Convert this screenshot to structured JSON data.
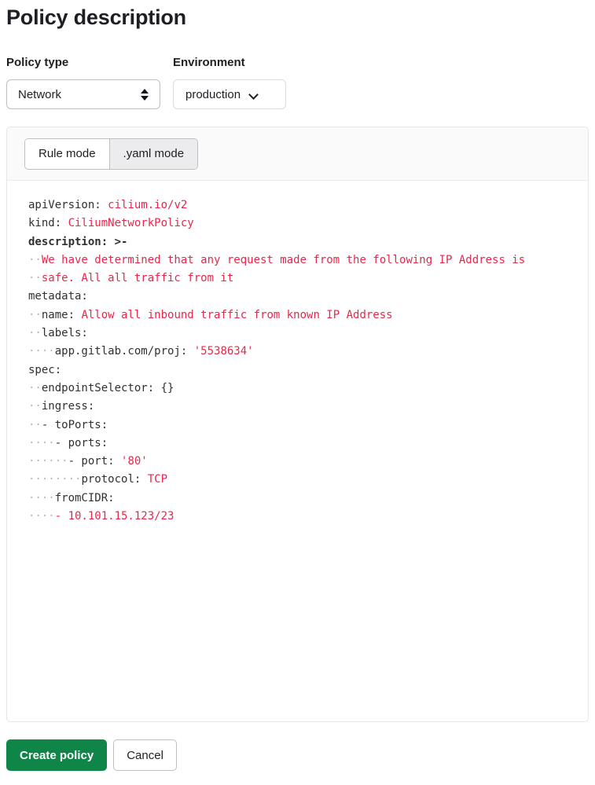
{
  "page": {
    "title": "Policy description"
  },
  "form": {
    "policy_type": {
      "label": "Policy type",
      "value": "Network",
      "icon": "stepper-updown-icon"
    },
    "environment": {
      "label": "Environment",
      "value": "production",
      "icon": "chevron-down-icon"
    }
  },
  "editor": {
    "tabs": [
      {
        "label": "Rule mode",
        "active": false
      },
      {
        "label": ".yaml mode",
        "active": true
      }
    ],
    "yaml_lines": [
      {
        "indent": 0,
        "key": "apiVersion: ",
        "value": "cilium.io/v2"
      },
      {
        "indent": 0,
        "key": "kind: ",
        "value": "CiliumNetworkPolicy"
      },
      {
        "indent": 0,
        "key": "description: >-",
        "value": ""
      },
      {
        "indent": 2,
        "key": "",
        "value": "We have determined that any request made from the following IP Address is"
      },
      {
        "indent": 2,
        "key": "",
        "value": "safe. All all traffic from it"
      },
      {
        "indent": 0,
        "key": "metadata:",
        "value": ""
      },
      {
        "indent": 2,
        "key": "name: ",
        "value": "Allow all inbound traffic from known IP Address"
      },
      {
        "indent": 2,
        "key": "labels:",
        "value": ""
      },
      {
        "indent": 4,
        "key": "app.gitlab.com/proj: ",
        "value": "'5538634'"
      },
      {
        "indent": 0,
        "key": "spec:",
        "value": ""
      },
      {
        "indent": 2,
        "key": "endpointSelector: {}",
        "value": ""
      },
      {
        "indent": 2,
        "key": "ingress:",
        "value": ""
      },
      {
        "indent": 2,
        "key": "- toPorts:",
        "value": ""
      },
      {
        "indent": 4,
        "key": "- ports:",
        "value": ""
      },
      {
        "indent": 6,
        "key": "- port: ",
        "value": "'80'"
      },
      {
        "indent": 8,
        "key": "protocol: ",
        "value": "TCP"
      },
      {
        "indent": 4,
        "key": "fromCIDR:",
        "value": ""
      },
      {
        "indent": 4,
        "key": "",
        "value": "- 10.101.15.123/23"
      }
    ]
  },
  "footer": {
    "create_label": "Create policy",
    "cancel_label": "Cancel"
  },
  "colors": {
    "primary_green": "#108548",
    "syntax_value_red": "#e8274b",
    "indent_dot_grey": "#b5b5b5"
  }
}
